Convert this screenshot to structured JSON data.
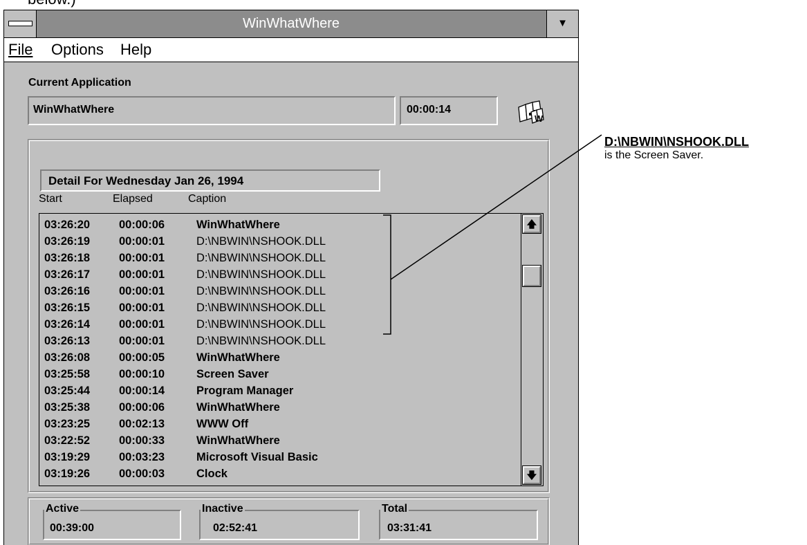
{
  "cropped_text": "below.)",
  "window": {
    "title": "WinWhatWhere",
    "dropdown_glyph": "▼"
  },
  "menu": {
    "file": "File",
    "options": "Options",
    "help": "Help"
  },
  "current_app": {
    "label": "Current Application",
    "name": "WinWhatWhere",
    "time": "00:00:14"
  },
  "detail": {
    "title": "Detail For Wednesday Jan 26, 1994",
    "columns": [
      "Start",
      "Elapsed",
      "Caption"
    ],
    "rows": [
      {
        "start": "03:26:20",
        "elapsed": "00:00:06",
        "caption": "WinWhatWhere"
      },
      {
        "start": "03:26:19",
        "elapsed": "00:00:01",
        "caption": "D:\\NBWIN\\NSHOOK.DLL"
      },
      {
        "start": "03:26:18",
        "elapsed": "00:00:01",
        "caption": "D:\\NBWIN\\NSHOOK.DLL"
      },
      {
        "start": "03:26:17",
        "elapsed": "00:00:01",
        "caption": "D:\\NBWIN\\NSHOOK.DLL"
      },
      {
        "start": "03:26:16",
        "elapsed": "00:00:01",
        "caption": "D:\\NBWIN\\NSHOOK.DLL"
      },
      {
        "start": "03:26:15",
        "elapsed": "00:00:01",
        "caption": "D:\\NBWIN\\NSHOOK.DLL"
      },
      {
        "start": "03:26:14",
        "elapsed": "00:00:01",
        "caption": "D:\\NBWIN\\NSHOOK.DLL"
      },
      {
        "start": "03:26:13",
        "elapsed": "00:00:01",
        "caption": "D:\\NBWIN\\NSHOOK.DLL"
      },
      {
        "start": "03:26:08",
        "elapsed": "00:00:05",
        "caption": "WinWhatWhere"
      },
      {
        "start": "03:25:58",
        "elapsed": "00:00:10",
        "caption": "Screen Saver"
      },
      {
        "start": "03:25:44",
        "elapsed": "00:00:14",
        "caption": "Program Manager"
      },
      {
        "start": "03:25:38",
        "elapsed": "00:00:06",
        "caption": "WinWhatWhere"
      },
      {
        "start": "03:23:25",
        "elapsed": "00:02:13",
        "caption": "WWW Off"
      },
      {
        "start": "03:22:52",
        "elapsed": "00:00:33",
        "caption": "WinWhatWhere"
      },
      {
        "start": "03:19:29",
        "elapsed": "00:03:23",
        "caption": "Microsoft Visual Basic"
      },
      {
        "start": "03:19:26",
        "elapsed": "00:00:03",
        "caption": "Clock"
      }
    ],
    "scroll_up_glyph": "🡅",
    "scroll_down_glyph": "🡇"
  },
  "totals": {
    "active_label": "Active",
    "active_value": "00:39:00",
    "inactive_label": "Inactive",
    "inactive_value": "02:52:41",
    "total_label": "Total",
    "total_value": "03:31:41"
  },
  "annotation": {
    "title": "D:\\NBWIN\\NSHOOK.DLL",
    "text": "is the Screen Saver."
  }
}
